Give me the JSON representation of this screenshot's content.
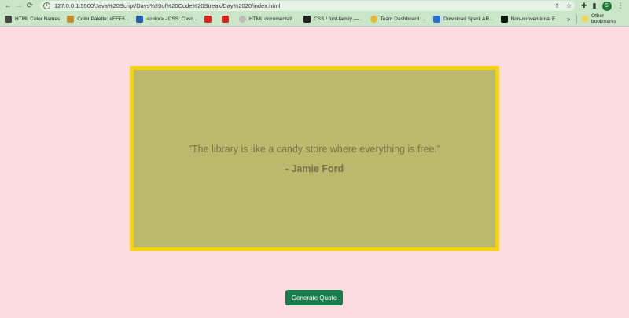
{
  "browser": {
    "url": "127.0.0.1:5500/Java%20Script/Days%20of%20Code%20Streak/Day%2020/index.html",
    "profile_initial": "S"
  },
  "bookmarks": [
    {
      "label": "HTML Color Names",
      "color": "#444444"
    },
    {
      "label": "Color Palette: #FFE6...",
      "color": "#c58a2a"
    },
    {
      "label": "<color> - CSS: Casc...",
      "color": "#2a5db0"
    },
    {
      "label": "",
      "color": "#e02020"
    },
    {
      "label": "",
      "color": "#e02020"
    },
    {
      "label": "HTML documentati...",
      "color": "#bbbbbb"
    },
    {
      "label": "CSS / font-family —...",
      "color": "#222222"
    },
    {
      "label": "Team Dashboard |...",
      "color": "#e8b730"
    },
    {
      "label": "Download Spark AR...",
      "color": "#2a6fd6"
    },
    {
      "label": "Non-conventional E...",
      "color": "#111111"
    }
  ],
  "bookmarks_more": "»",
  "other_bookmarks": "Other bookmarks",
  "quote": {
    "text": "\"The library is like a candy store where everything is free.\"",
    "author": "- Jamie Ford"
  },
  "button": {
    "label": "Generate Quote"
  },
  "colors": {
    "background": "#fcdce0",
    "quote_box": "#bbb96b",
    "quote_border": "#f6d40c",
    "button": "#1a7b4b"
  }
}
